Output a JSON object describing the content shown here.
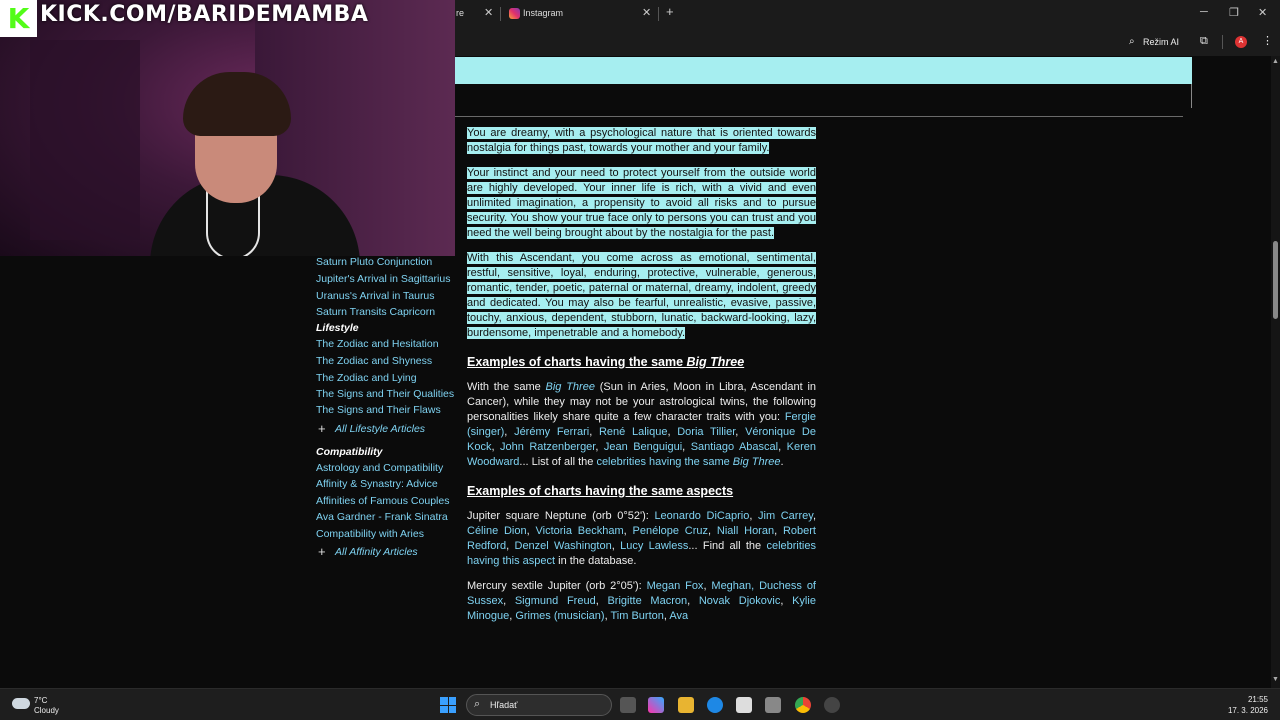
{
  "overlay": {
    "kick_logo": "K",
    "url": "KICK.COM/BARIDEMAMBA"
  },
  "browser": {
    "tab_active_label": "Instagram",
    "tab_partial_label": "re",
    "toolbar_mode": "Režim AI",
    "avatar_letter": "A"
  },
  "sidebar": {
    "items_top": [
      "Saturn Pluto Conjunction",
      "Jupiter's Arrival in Sagittarius",
      "Uranus's Arrival in Taurus",
      "Saturn Transits Capricorn"
    ],
    "lifestyle_heading": "Lifestyle",
    "lifestyle_items": [
      "The Zodiac and Hesitation",
      "The Zodiac and Shyness",
      "The Zodiac and Lying",
      "The Signs and Their Qualities",
      "The Signs and Their Flaws"
    ],
    "lifestyle_more": "All Lifestyle Articles",
    "compat_heading": "Compatibility",
    "compat_items": [
      "Astrology and Compatibility",
      "Affinity & Synastry: Advice",
      "Affinities of Famous Couples",
      "Ava Gardner - Frank Sinatra",
      "Compatibility with Aries"
    ],
    "compat_more": "All Affinity Articles"
  },
  "article": {
    "p1": "You are dreamy, with a psychological nature that is oriented towards nostalgia for things past, towards your mother and your family.",
    "p2": "Your instinct and your need to protect yourself from the outside world are highly developed. Your inner life is rich, with a vivid and even unlimited imagination, a propensity to avoid all risks and to pursue security. You show your true face only to persons you can trust and you need the well being brought about by the nostalgia for the past.",
    "p3": "With this Ascendant, you come across as emotional, sentimental, restful, sensitive, loyal, enduring, protective, vulnerable, generous, romantic, tender, poetic, paternal or maternal, dreamy, indolent, greedy and dedicated. You may also be fearful, unrealistic, evasive, passive, touchy, anxious, dependent, stubborn, lunatic, backward-looking, lazy, burdensome, impenetrable and a homebody.",
    "h1_prefix": "Examples of charts having the same ",
    "h1_italic": "Big Three",
    "s1_a": "With the same ",
    "s1_big": "Big Three",
    "s1_b": " (Sun in Aries, Moon in Libra, Ascendant in Cancer), while they may not be your astrological twins, the following personalities likely share quite a few character traits with you: ",
    "s1_people": [
      "Fergie (singer)",
      "Jérémy Ferrari",
      "René Lalique",
      "Doria Tillier",
      "Véronique De Kock",
      "John Ratzenberger",
      "Jean Benguigui",
      "Santiago Abascal",
      "Keren Woodward"
    ],
    "s1_c": "... List of all the ",
    "s1_link": "celebrities having the same ",
    "s1_link_it": "Big Three",
    "s1_end": ".",
    "h2": "Examples of charts having the same aspects",
    "s2_a": "Jupiter square Neptune (orb 0°52'): ",
    "s2_people": [
      "Leonardo DiCaprio",
      "Jim Carrey",
      "Céline Dion",
      "Victoria Beckham",
      "Penélope Cruz",
      "Niall Horan",
      "Robert Redford",
      "Denzel Washington",
      "Lucy Lawless"
    ],
    "s2_b": "... Find all the ",
    "s2_link": "celebrities having this aspect",
    "s2_c": " in the database.",
    "s3_a": "Mercury sextile Jupiter (orb 2°05'): ",
    "s3_people": [
      "Megan Fox",
      "Meghan, Duchess of Sussex",
      "Sigmund Freud",
      "Brigitte Macron",
      "Novak Djokovic",
      "Kylie Minogue",
      "Grimes (musician)",
      "Tim Burton",
      "Ava"
    ]
  },
  "taskbar": {
    "temp": "7°C",
    "weather": "Cloudy",
    "search_placeholder": "Hľadať",
    "time": "21:55",
    "date": "17. 3. 2026"
  },
  "colors": {
    "highlight": "#a6eef0",
    "link": "#7fd3f2",
    "background": "#0b0b0b"
  }
}
